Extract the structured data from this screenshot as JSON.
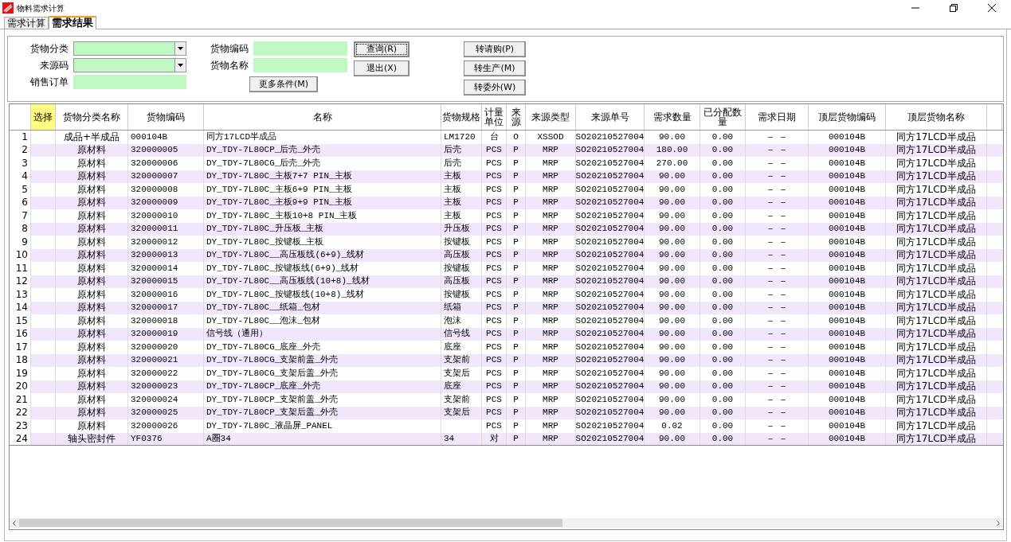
{
  "window": {
    "title": "物料需求计算"
  },
  "tabs": [
    {
      "label": "需求计算",
      "selected": false
    },
    {
      "label": "需求结果",
      "selected": true
    }
  ],
  "filters": {
    "left": [
      {
        "label": "货物分类",
        "kind": "dropdown"
      },
      {
        "label": "来源码",
        "kind": "dropdown"
      },
      {
        "label": "销售订单",
        "kind": "text"
      }
    ],
    "middle": [
      {
        "label": "货物编码",
        "kind": "text"
      },
      {
        "label": "货物名称",
        "kind": "text"
      }
    ],
    "more_button": "更多条件(M)",
    "actions": [
      {
        "label": "查询(R)",
        "focused": true
      },
      {
        "label": "退出(X)",
        "focused": false
      }
    ],
    "convert_buttons": [
      "转请购(P)",
      "转生产(M)",
      "转委外(W)"
    ]
  },
  "table": {
    "columns": [
      "",
      "选择",
      "货物分类名称",
      "货物编码",
      "名称",
      "货物规格",
      "计量单位",
      "来源",
      "来源类型",
      "来源单号",
      "需求数量",
      "已分配数量",
      "需求日期",
      "顶层货物编码",
      "顶层货物名称"
    ],
    "rows": [
      [
        "1",
        "",
        "成品+半成品",
        "000104B",
        "同方17LCD半成品",
        "LM1720",
        "台",
        "O",
        "XSSOD",
        "SO20210527004",
        "90.00",
        "0.00",
        "－ －",
        "000104B",
        "同方17LCD半成品"
      ],
      [
        "2",
        "",
        "原材料",
        "320000005",
        "DY_TDY-7L80CP_后壳_外壳",
        "后壳",
        "PCS",
        "P",
        "MRP",
        "SO20210527004",
        "180.00",
        "0.00",
        "－ －",
        "000104B",
        "同方17LCD半成品"
      ],
      [
        "3",
        "",
        "原材料",
        "320000006",
        "DY_TDY-7L80CG_后壳_外壳",
        "后壳",
        "PCS",
        "P",
        "MRP",
        "SO20210527004",
        "270.00",
        "0.00",
        "－ －",
        "000104B",
        "同方17LCD半成品"
      ],
      [
        "4",
        "",
        "原材料",
        "320000007",
        "DY_TDY-7L80C_主板7+7 PIN_主板",
        "主板",
        "PCS",
        "P",
        "MRP",
        "SO20210527004",
        "90.00",
        "0.00",
        "－ －",
        "000104B",
        "同方17LCD半成品"
      ],
      [
        "5",
        "",
        "原材料",
        "320000008",
        "DY_TDY-7L80C_主板6+9 PIN_主板",
        "主板",
        "PCS",
        "P",
        "MRP",
        "SO20210527004",
        "90.00",
        "0.00",
        "－ －",
        "000104B",
        "同方17LCD半成品"
      ],
      [
        "6",
        "",
        "原材料",
        "320000009",
        "DY_TDY-7L80C_主板9+9 PIN_主板",
        "主板",
        "PCS",
        "P",
        "MRP",
        "SO20210527004",
        "90.00",
        "0.00",
        "－ －",
        "000104B",
        "同方17LCD半成品"
      ],
      [
        "7",
        "",
        "原材料",
        "320000010",
        "DY_TDY-7L80C_主板10+8 PIN_主板",
        "主板",
        "PCS",
        "P",
        "MRP",
        "SO20210527004",
        "90.00",
        "0.00",
        "－ －",
        "000104B",
        "同方17LCD半成品"
      ],
      [
        "8",
        "",
        "原材料",
        "320000011",
        "DY_TDY-7L80C_升压板_主板",
        "升压板",
        "PCS",
        "P",
        "MRP",
        "SO20210527004",
        "90.00",
        "0.00",
        "－ －",
        "000104B",
        "同方17LCD半成品"
      ],
      [
        "9",
        "",
        "原材料",
        "320000012",
        "DY_TDY-7L80C_按键板_主板",
        "按键板",
        "PCS",
        "P",
        "MRP",
        "SO20210527004",
        "90.00",
        "0.00",
        "－ －",
        "000104B",
        "同方17LCD半成品"
      ],
      [
        "10",
        "",
        "原材料",
        "320000013",
        "DY_TDY-7L80C__高压板线(6+9)_线材",
        "高压板",
        "PCS",
        "P",
        "MRP",
        "SO20210527004",
        "90.00",
        "0.00",
        "－ －",
        "000104B",
        "同方17LCD半成品"
      ],
      [
        "11",
        "",
        "原材料",
        "320000014",
        "DY_TDY-7L80C_按键板线(6+9)_线材",
        "按键板",
        "PCS",
        "P",
        "MRP",
        "SO20210527004",
        "90.00",
        "0.00",
        "－ －",
        "000104B",
        "同方17LCD半成品"
      ],
      [
        "12",
        "",
        "原材料",
        "320000015",
        "DY_TDY-7L80C__高压板线(10+8)_线材",
        "高压板",
        "PCS",
        "P",
        "MRP",
        "SO20210527004",
        "90.00",
        "0.00",
        "－ －",
        "000104B",
        "同方17LCD半成品"
      ],
      [
        "13",
        "",
        "原材料",
        "320000016",
        "DY_TDY-7L80C_按键板线(10+8)_线材",
        "按键板",
        "PCS",
        "P",
        "MRP",
        "SO20210527004",
        "90.00",
        "0.00",
        "－ －",
        "000104B",
        "同方17LCD半成品"
      ],
      [
        "14",
        "",
        "原材料",
        "320000017",
        "DY_TDY-7L80C__纸箱_包材",
        "纸箱",
        "PCS",
        "P",
        "MRP",
        "SO20210527004",
        "90.00",
        "0.00",
        "－ －",
        "000104B",
        "同方17LCD半成品"
      ],
      [
        "15",
        "",
        "原材料",
        "320000018",
        "DY_TDY-7L80C__泡沫_包材",
        "泡沫",
        "PCS",
        "P",
        "MRP",
        "SO20210527004",
        "90.00",
        "0.00",
        "－ －",
        "000104B",
        "同方17LCD半成品"
      ],
      [
        "16",
        "",
        "原材料",
        "320000019",
        "信号线（通用）",
        "信号线",
        "PCS",
        "P",
        "MRP",
        "SO20210527004",
        "90.00",
        "0.00",
        "－ －",
        "000104B",
        "同方17LCD半成品"
      ],
      [
        "17",
        "",
        "原材料",
        "320000020",
        "DY_TDY-7L80CG_底座_外壳",
        "底座",
        "PCS",
        "P",
        "MRP",
        "SO20210527004",
        "90.00",
        "0.00",
        "－ －",
        "000104B",
        "同方17LCD半成品"
      ],
      [
        "18",
        "",
        "原材料",
        "320000021",
        "DY_TDY-7L80CG_支架前盖_外壳",
        "支架前",
        "PCS",
        "P",
        "MRP",
        "SO20210527004",
        "90.00",
        "0.00",
        "－ －",
        "000104B",
        "同方17LCD半成品"
      ],
      [
        "19",
        "",
        "原材料",
        "320000022",
        "DY_TDY-7L80CG_支架后盖_外壳",
        "支架后",
        "PCS",
        "P",
        "MRP",
        "SO20210527004",
        "90.00",
        "0.00",
        "－ －",
        "000104B",
        "同方17LCD半成品"
      ],
      [
        "20",
        "",
        "原材料",
        "320000023",
        "DY_TDY-7L80CP_底座_外壳",
        "底座",
        "PCS",
        "P",
        "MRP",
        "SO20210527004",
        "90.00",
        "0.00",
        "－ －",
        "000104B",
        "同方17LCD半成品"
      ],
      [
        "21",
        "",
        "原材料",
        "320000024",
        "DY_TDY-7L80CP_支架前盖_外壳",
        "支架前",
        "PCS",
        "P",
        "MRP",
        "SO20210527004",
        "90.00",
        "0.00",
        "－ －",
        "000104B",
        "同方17LCD半成品"
      ],
      [
        "22",
        "",
        "原材料",
        "320000025",
        "DY_TDY-7L80CP_支架后盖_外壳",
        "支架后",
        "PCS",
        "P",
        "MRP",
        "SO20210527004",
        "90.00",
        "0.00",
        "－ －",
        "000104B",
        "同方17LCD半成品"
      ],
      [
        "23",
        "",
        "原材料",
        "320000026",
        "DY_TDY-7L80C_液晶屏_PANEL",
        "",
        "PCS",
        "P",
        "MRP",
        "SO20210527004",
        "0.02",
        "0.00",
        "－ －",
        "000104B",
        "同方17LCD半成品"
      ],
      [
        "24",
        "",
        "轴头密封件",
        "YF0376",
        "A圈34",
        "34",
        "对",
        "P",
        "MRP",
        "SO20210527004",
        "90.00",
        "0.00",
        "－ －",
        "000104B",
        "同方17LCD半成品"
      ]
    ]
  }
}
